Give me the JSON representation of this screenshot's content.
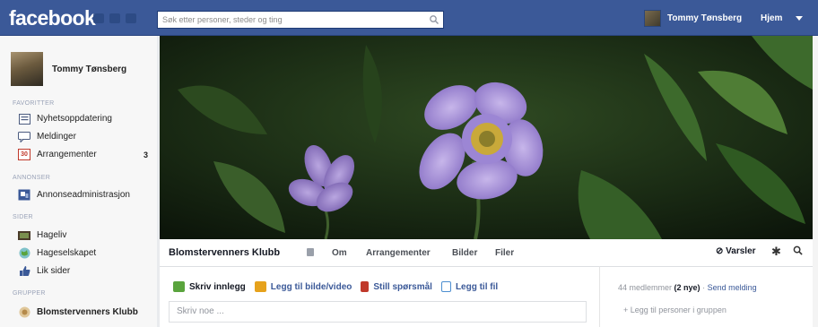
{
  "topbar": {
    "logo": "facebook",
    "search_placeholder": "Søk etter personer, steder og ting",
    "user_name": "Tommy Tønsberg",
    "home_label": "Hjem"
  },
  "sidebar": {
    "profile_name": "Tommy Tønsberg",
    "sections": {
      "favorites": "FAVORITTER",
      "ads": "ANNONSER",
      "pages": "SIDER",
      "groups": "GRUPPER"
    },
    "favorites": [
      {
        "label": "Nyhetsoppdatering",
        "icon": "news-feed-icon"
      },
      {
        "label": "Meldinger",
        "icon": "messages-icon"
      },
      {
        "label": "Arrangementer",
        "icon": "events-icon",
        "count": "3"
      }
    ],
    "ads": [
      {
        "label": "Annonseadministrasjon",
        "icon": "ads-manager-icon"
      }
    ],
    "pages": [
      {
        "label": "Hageliv",
        "icon": "flag-icon"
      },
      {
        "label": "Hageselskapet",
        "icon": "globe-icon"
      },
      {
        "label": "Lik sider",
        "icon": "thumbs-up-icon"
      }
    ],
    "groups": [
      {
        "label": "Blomstervenners Klubb",
        "icon": "group-icon"
      }
    ],
    "events_icon_text": "30"
  },
  "group": {
    "name": "Blomstervenners Klubb",
    "tabs": [
      "Om",
      "Arrangementer",
      "Bilder",
      "Filer"
    ],
    "notifications_label": "Varsler"
  },
  "composer": {
    "actions": [
      {
        "label": "Skriv innlegg",
        "icon": "status-icon",
        "color": "#5aa43d"
      },
      {
        "label": "Legg til bilde/video",
        "icon": "photo-icon",
        "color": "#e6a21c"
      },
      {
        "label": "Still spørsmål",
        "icon": "question-icon",
        "color": "#c0392b"
      },
      {
        "label": "Legg til fil",
        "icon": "file-icon",
        "color": "#4c8ed0"
      }
    ],
    "placeholder": "Skriv noe ..."
  },
  "right": {
    "members_text": "44 medlemmer",
    "new_text": "(2 nye)",
    "send_message": "Send melding",
    "add_people": "+ Legg til personer i gruppen"
  },
  "colors": {
    "brand": "#3b5998",
    "link": "#3b5998",
    "background": "#e9ebee"
  }
}
